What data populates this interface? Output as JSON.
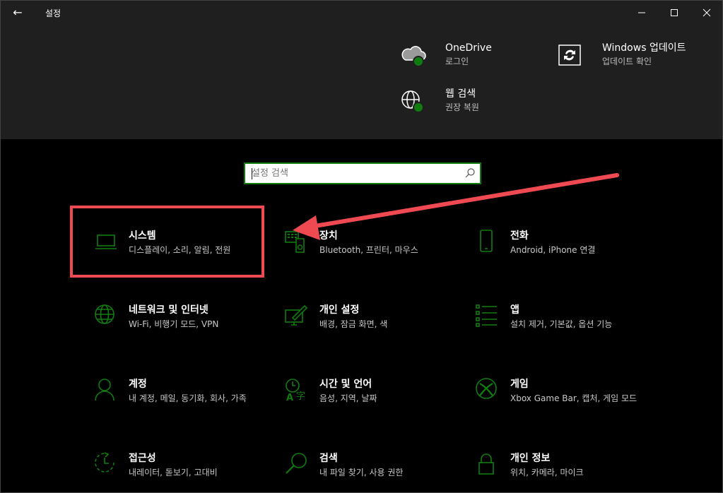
{
  "titlebar": {
    "title": "설정",
    "back_glyph": "←",
    "min_label": "minimize",
    "max_label": "maximize",
    "close_label": "close"
  },
  "quick_links": {
    "onedrive": {
      "title": "OneDrive",
      "subtitle": "로그인",
      "icon": "cloud-icon"
    },
    "windows_update": {
      "title": "Windows 업데이트",
      "subtitle": "업데이트 확인",
      "icon": "refresh-icon"
    },
    "web_search": {
      "title": "웹 검색",
      "subtitle": "권장 복원",
      "icon": "globe-icon"
    }
  },
  "search": {
    "placeholder": "설정 검색",
    "value": ""
  },
  "tiles": [
    {
      "name": "시스템",
      "desc": "디스플레이, 소리, 알림, 전원",
      "icon": "laptop-icon"
    },
    {
      "name": "장치",
      "desc": "Bluetooth, 프린터, 마우스",
      "icon": "devices-icon"
    },
    {
      "name": "전화",
      "desc": "Android, iPhone 연결",
      "icon": "phone-icon"
    },
    {
      "name": "네트워크 및 인터넷",
      "desc": "Wi-Fi, 비행기 모드, VPN",
      "icon": "globe-icon"
    },
    {
      "name": "개인 설정",
      "desc": "배경, 잠금 화면, 색",
      "icon": "paint-icon"
    },
    {
      "name": "앱",
      "desc": "설치 제거, 기본값, 옵션 기능",
      "icon": "apps-list-icon"
    },
    {
      "name": "계정",
      "desc": "내 계정, 메일, 동기화, 회사, 가족",
      "icon": "person-icon"
    },
    {
      "name": "시간 및 언어",
      "desc": "음성, 지역, 날짜",
      "icon": "time-language-icon"
    },
    {
      "name": "게임",
      "desc": "Xbox Game Bar, 캡처, 게임 모드",
      "icon": "xbox-icon"
    },
    {
      "name": "접근성",
      "desc": "내레이터, 돋보기, 고대비",
      "icon": "accessibility-icon"
    },
    {
      "name": "검색",
      "desc": "내 파일 찾기, 사용 권한",
      "icon": "search-icon"
    },
    {
      "name": "개인 정보",
      "desc": "위치, 카메라, 마이크",
      "icon": "lock-icon"
    }
  ],
  "colors": {
    "accent": "#107c10",
    "annotation_red": "#ef4a52",
    "background": "#000000",
    "header_bg": "#1f1f1f"
  }
}
